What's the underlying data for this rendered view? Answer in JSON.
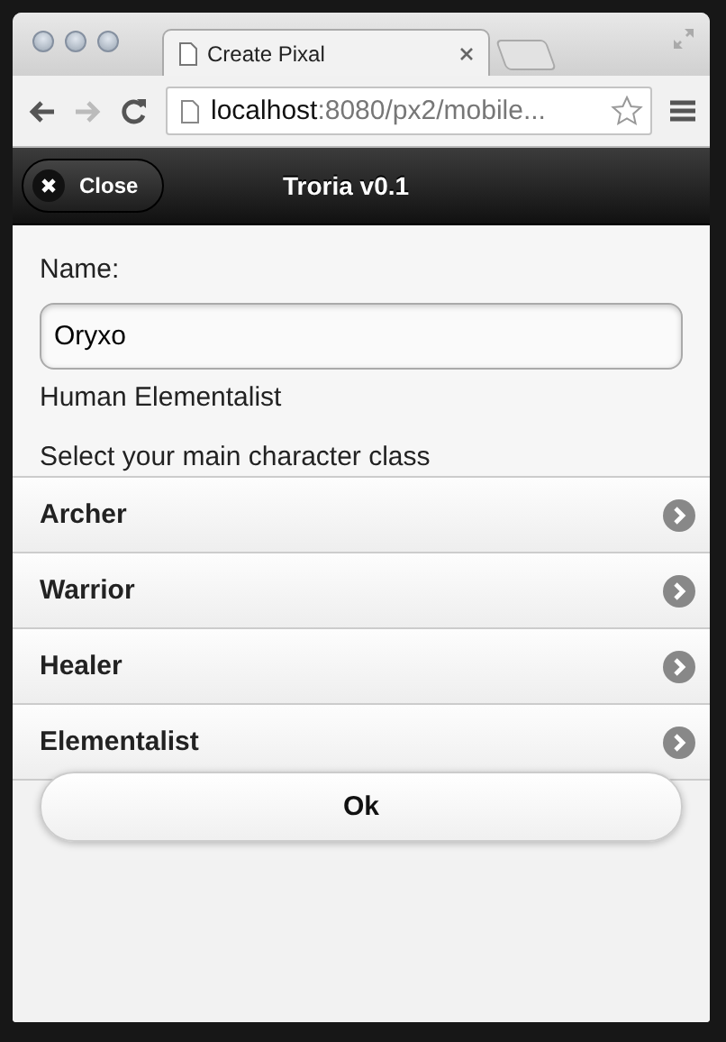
{
  "browser": {
    "tab_title": "Create Pixal",
    "url_host": "localhost",
    "url_path": ":8080/px2/mobile..."
  },
  "header": {
    "close_button": "Close",
    "title": "Troria v0.1"
  },
  "form": {
    "name_label": "Name:",
    "name_value": "Oryxo",
    "description": "Human Elementalist",
    "prompt": "Select your main character class"
  },
  "classes": [
    {
      "label": "Archer"
    },
    {
      "label": "Warrior"
    },
    {
      "label": "Healer"
    },
    {
      "label": "Elementalist"
    }
  ],
  "ok_button": "Ok"
}
